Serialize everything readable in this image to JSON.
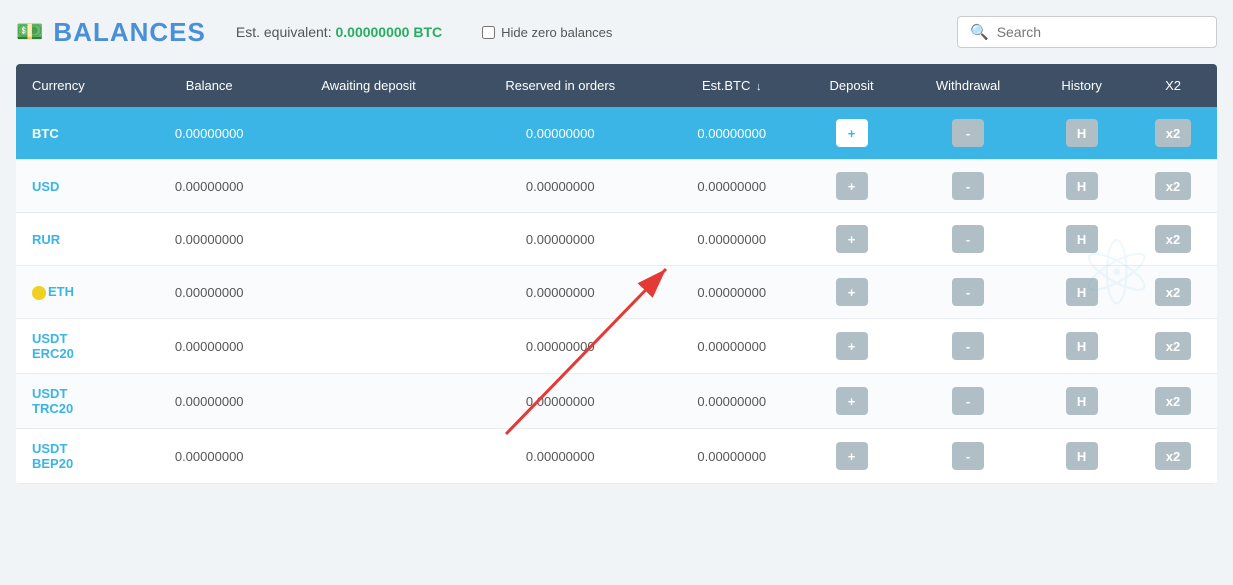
{
  "header": {
    "title": "BALANCES",
    "est_label": "Est. equivalent:",
    "est_value": "0.00000000 BTC",
    "hide_zero_label": "Hide zero balances",
    "search_placeholder": "Search"
  },
  "table": {
    "columns": [
      {
        "key": "currency",
        "label": "Currency"
      },
      {
        "key": "balance",
        "label": "Balance"
      },
      {
        "key": "awaiting_deposit",
        "label": "Awaiting deposit"
      },
      {
        "key": "reserved_in_orders",
        "label": "Reserved in orders"
      },
      {
        "key": "est_btc",
        "label": "Est.BTC",
        "sortable": true
      },
      {
        "key": "deposit",
        "label": "Deposit"
      },
      {
        "key": "withdrawal",
        "label": "Withdrawal"
      },
      {
        "key": "history",
        "label": "History"
      },
      {
        "key": "x2",
        "label": "X2"
      }
    ],
    "rows": [
      {
        "currency": "BTC",
        "balance": "0.00000000",
        "awaiting": "",
        "reserved": "0.00000000",
        "est_btc": "0.00000000",
        "active": true
      },
      {
        "currency": "USD",
        "balance": "0.00000000",
        "awaiting": "",
        "reserved": "0.00000000",
        "est_btc": "0.00000000",
        "active": false
      },
      {
        "currency": "RUR",
        "balance": "0.00000000",
        "awaiting": "",
        "reserved": "0.00000000",
        "est_btc": "0.00000000",
        "active": false
      },
      {
        "currency": "ETH",
        "balance": "0.00000000",
        "awaiting": "",
        "reserved": "0.00000000",
        "est_btc": "0.00000000",
        "active": false,
        "has_dot": true
      },
      {
        "currency": "USDT\nERC20",
        "balance": "0.00000000",
        "awaiting": "",
        "reserved": "0.00000000",
        "est_btc": "0.00000000",
        "active": false
      },
      {
        "currency": "USDT\nTRC20",
        "balance": "0.00000000",
        "awaiting": "",
        "reserved": "0.00000000",
        "est_btc": "0.00000000",
        "active": false
      },
      {
        "currency": "USDT\nBEP20",
        "balance": "0.00000000",
        "awaiting": "",
        "reserved": "0.00000000",
        "est_btc": "0.00000000",
        "active": false
      }
    ],
    "btn_deposit": "+",
    "btn_withdraw": "-",
    "btn_history": "H",
    "btn_x2": "x2"
  },
  "colors": {
    "header_bg": "#3d5066",
    "active_row": "#3ab5e5",
    "link_color": "#3ab5e5",
    "btn_gray": "#b0bec5",
    "est_green": "#27ae60",
    "title_blue": "#4a90d9"
  }
}
